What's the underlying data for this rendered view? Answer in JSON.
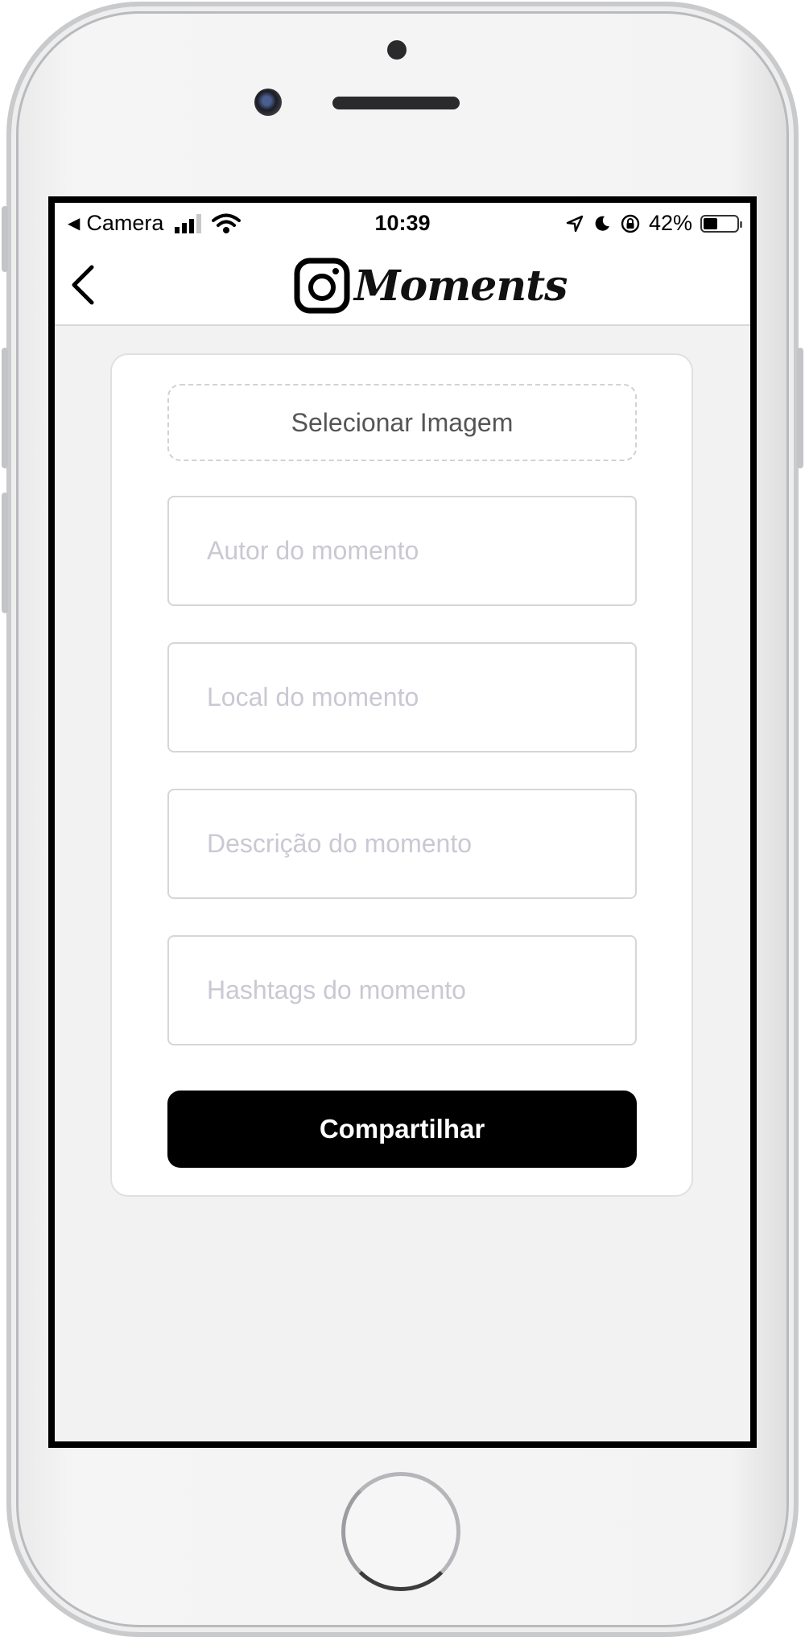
{
  "status_bar": {
    "back_app": "Camera",
    "time": "10:39",
    "battery_percent": "42%",
    "battery_level": 0.42
  },
  "nav": {
    "logo_text": "Moments"
  },
  "form": {
    "select_image_label": "Selecionar Imagem",
    "author_placeholder": "Autor do momento",
    "author_value": "",
    "location_placeholder": "Local do momento",
    "location_value": "",
    "description_placeholder": "Descrição do momento",
    "description_value": "",
    "hashtags_placeholder": "Hashtags do momento",
    "hashtags_value": "",
    "share_label": "Compartilhar"
  },
  "colors": {
    "primary_button": "#000000",
    "background": "#f2f2f2",
    "placeholder": "#c9c9d3"
  }
}
